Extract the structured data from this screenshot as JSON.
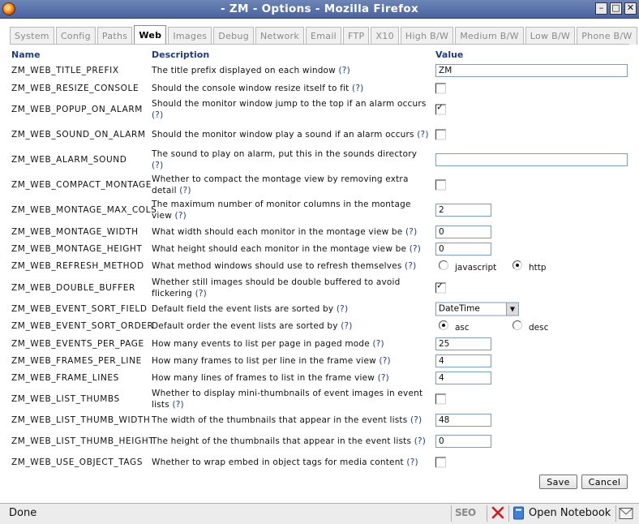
{
  "window": {
    "title": "- ZM - Options - Mozilla Firefox",
    "min_glyph": "–",
    "max_glyph": "□",
    "close_glyph": "✕"
  },
  "tabs": [
    "System",
    "Config",
    "Paths",
    "Web",
    "Images",
    "Debug",
    "Network",
    "Email",
    "FTP",
    "X10",
    "High B/W",
    "Medium B/W",
    "Low B/W",
    "Phone B/W"
  ],
  "active_tab": "Web",
  "headers": {
    "name": "Name",
    "description": "Description",
    "value": "Value"
  },
  "help_text": "(?)",
  "options": [
    {
      "name": "ZM_WEB_TITLE_PREFIX",
      "desc": "The title prefix displayed on each window",
      "type": "text-wide",
      "value": "ZM"
    },
    {
      "name": "ZM_WEB_RESIZE_CONSOLE",
      "desc": "Should the console window resize itself to fit",
      "type": "checkbox",
      "checked": false
    },
    {
      "name": "ZM_WEB_POPUP_ON_ALARM",
      "desc": "Should the monitor window jump to the top if an alarm occurs",
      "type": "checkbox",
      "checked": true
    },
    {
      "name": "ZM_WEB_SOUND_ON_ALARM",
      "desc": "Should the monitor window play a sound if an alarm occurs",
      "type": "checkbox",
      "checked": false
    },
    {
      "name": "ZM_WEB_ALARM_SOUND",
      "desc": "The sound to play on alarm, put this in the sounds directory",
      "type": "text-wide",
      "value": ""
    },
    {
      "name": "ZM_WEB_COMPACT_MONTAGE",
      "desc": "Whether to compact the montage view by removing extra detail",
      "type": "checkbox",
      "checked": false
    },
    {
      "name": "ZM_WEB_MONTAGE_MAX_COLS",
      "desc": "The maximum number of monitor columns in the montage view",
      "type": "text-narrow",
      "value": "2"
    },
    {
      "name": "ZM_WEB_MONTAGE_WIDTH",
      "desc": "What width should each monitor in the montage view be",
      "type": "text-narrow",
      "value": "0"
    },
    {
      "name": "ZM_WEB_MONTAGE_HEIGHT",
      "desc": "What height should each monitor in the montage view be",
      "type": "text-narrow",
      "value": "0"
    },
    {
      "name": "ZM_WEB_REFRESH_METHOD",
      "desc": "What method windows should use to refresh themselves",
      "type": "radio",
      "options": [
        "javascript",
        "http"
      ],
      "selected": "http"
    },
    {
      "name": "ZM_WEB_DOUBLE_BUFFER",
      "desc": "Whether still images should be double buffered to avoid flickering",
      "type": "checkbox",
      "checked": true
    },
    {
      "name": "ZM_WEB_EVENT_SORT_FIELD",
      "desc": "Default field the event lists are sorted by",
      "type": "select",
      "value": "DateTime"
    },
    {
      "name": "ZM_WEB_EVENT_SORT_ORDER",
      "desc": "Default order the event lists are sorted by",
      "type": "radio",
      "options": [
        "asc",
        "desc"
      ],
      "selected": "asc"
    },
    {
      "name": "ZM_WEB_EVENTS_PER_PAGE",
      "desc": "How many events to list per page in paged mode",
      "type": "text-narrow",
      "value": "25"
    },
    {
      "name": "ZM_WEB_FRAMES_PER_LINE",
      "desc": "How many frames to list per line in the frame view",
      "type": "text-narrow",
      "value": "4"
    },
    {
      "name": "ZM_WEB_FRAME_LINES",
      "desc": "How many lines of frames to list in the frame view",
      "type": "text-narrow",
      "value": "4"
    },
    {
      "name": "ZM_WEB_LIST_THUMBS",
      "desc": "Whether to display mini-thumbnails of event images in event lists",
      "type": "checkbox",
      "checked": false
    },
    {
      "name": "ZM_WEB_LIST_THUMB_WIDTH",
      "desc": "The width of the thumbnails that appear in the event lists",
      "type": "text-narrow",
      "value": "48"
    },
    {
      "name": "ZM_WEB_LIST_THUMB_HEIGHT",
      "desc": "The height of the thumbnails that appear in the event lists",
      "type": "text-narrow",
      "value": "0"
    },
    {
      "name": "ZM_WEB_USE_OBJECT_TAGS",
      "desc": "Whether to wrap embed in object tags for media content",
      "type": "checkbox",
      "checked": false
    }
  ],
  "buttons": {
    "save": "Save",
    "cancel": "Cancel"
  },
  "statusbar": {
    "text": "Done",
    "seo_label": "SEO",
    "notebook": "Open Notebook"
  }
}
